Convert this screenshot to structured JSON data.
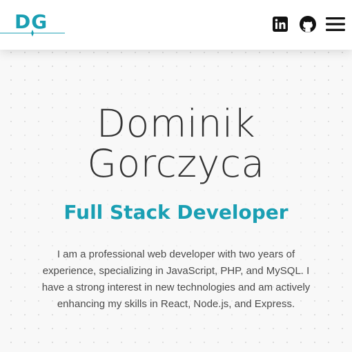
{
  "header": {
    "logo_text": "DG",
    "icons": [
      "linkedin-icon",
      "github-icon",
      "hamburger-menu-icon"
    ]
  },
  "hero": {
    "first_name": "Dominik",
    "last_name": "Gorczyca",
    "role": "Full Stack Developer",
    "bio": "I am a professional web developer with two years of experience, specializing in JavaScript, PHP, and MySQL. I have a strong interest in new technologies and am actively enhancing my skills in React, Node.js, and Express."
  },
  "colors": {
    "accent": "#1a9fb3",
    "text_dark": "#333333",
    "text_body": "#4a4a4a",
    "background": "#f8f8f8"
  }
}
